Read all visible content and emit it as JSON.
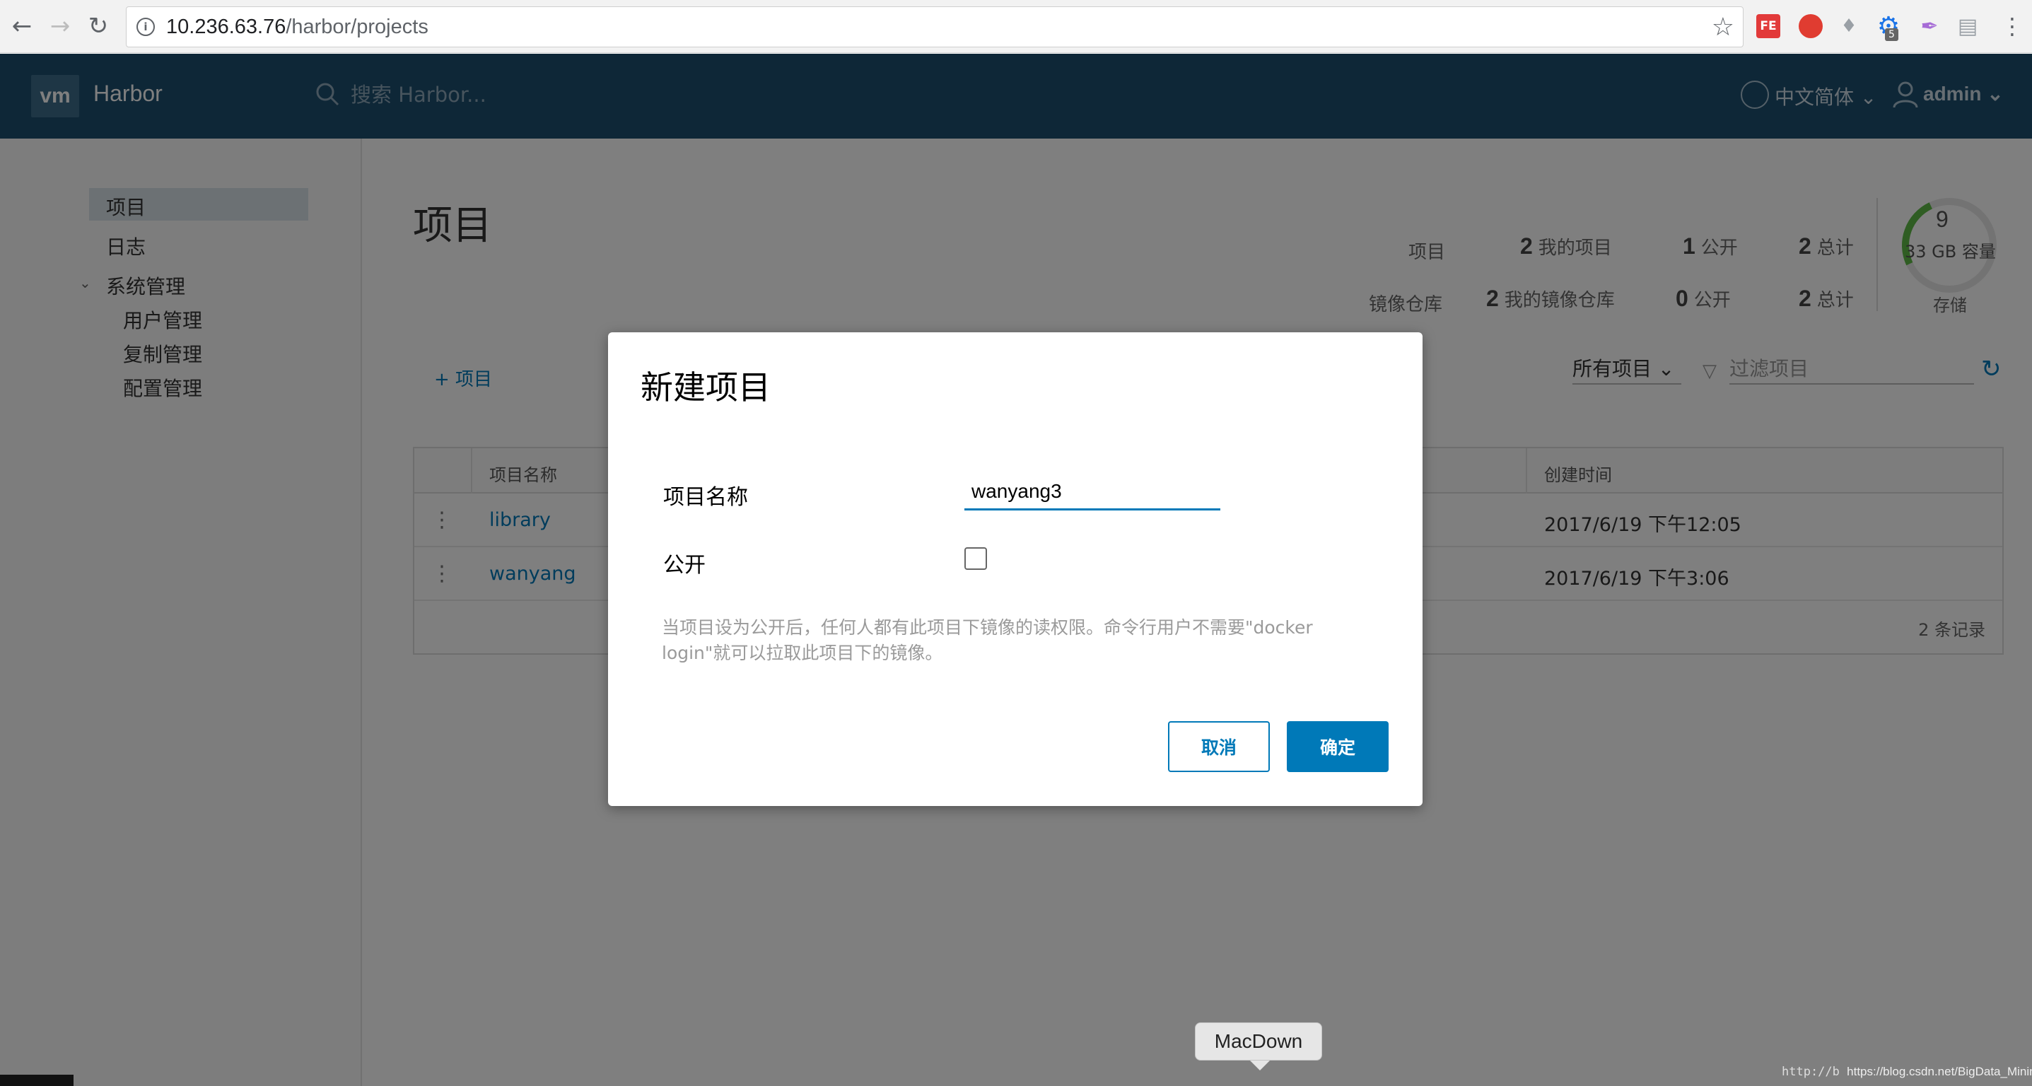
{
  "browser": {
    "url_host": "10.236.63.76",
    "url_path": "/harbor/projects",
    "ext_fe_label": "FE",
    "ext_badge": "5"
  },
  "header": {
    "logo": "vm",
    "brand": "Harbor",
    "search_placeholder": "搜索 Harbor...",
    "language": "中文简体",
    "username": "admin"
  },
  "sidebar": {
    "items": [
      {
        "label": "项目"
      },
      {
        "label": "日志"
      },
      {
        "label": "系统管理"
      },
      {
        "label": "用户管理"
      },
      {
        "label": "复制管理"
      },
      {
        "label": "配置管理"
      }
    ]
  },
  "page": {
    "title": "项目",
    "stats": {
      "projects_label": "项目",
      "my_projects_count": "2",
      "my_projects_label": "我的项目",
      "public_projects_count": "1",
      "public_label": "公开",
      "total_projects_count": "2",
      "total_label": "总计",
      "repos_label": "镜像仓库",
      "my_repos_count": "2",
      "my_repos_label": "我的镜像仓库",
      "public_repos_count": "0",
      "total_repos_count": "2"
    },
    "storage": {
      "value": "9",
      "capacity": "33 GB 容量",
      "label": "存储"
    },
    "add_button": "+ 项目",
    "filter_select": "所有项目",
    "filter_placeholder": "过滤项目",
    "table": {
      "columns": [
        "项目名称",
        "创建时间"
      ],
      "rows": [
        {
          "name": "library",
          "created": "2017/6/19 下午12:05"
        },
        {
          "name": "wanyang",
          "created": "2017/6/19 下午3:06"
        }
      ],
      "footer": "2 条记录"
    }
  },
  "modal": {
    "title": "新建项目",
    "name_label": "项目名称",
    "name_value": "wanyang3",
    "public_label": "公开",
    "public_checked": false,
    "help_text": "当项目设为公开后，任何人都有此项目下镜像的读权限。命令行用户不需要\"docker login\"就可以拉取此项目下的镜像。",
    "cancel_label": "取消",
    "ok_label": "确定"
  },
  "dock": {
    "tooltip": "MacDown"
  },
  "watermark": {
    "prefix": "http://b",
    "url": "https://blog.csdn.net/BigData_Mining"
  }
}
